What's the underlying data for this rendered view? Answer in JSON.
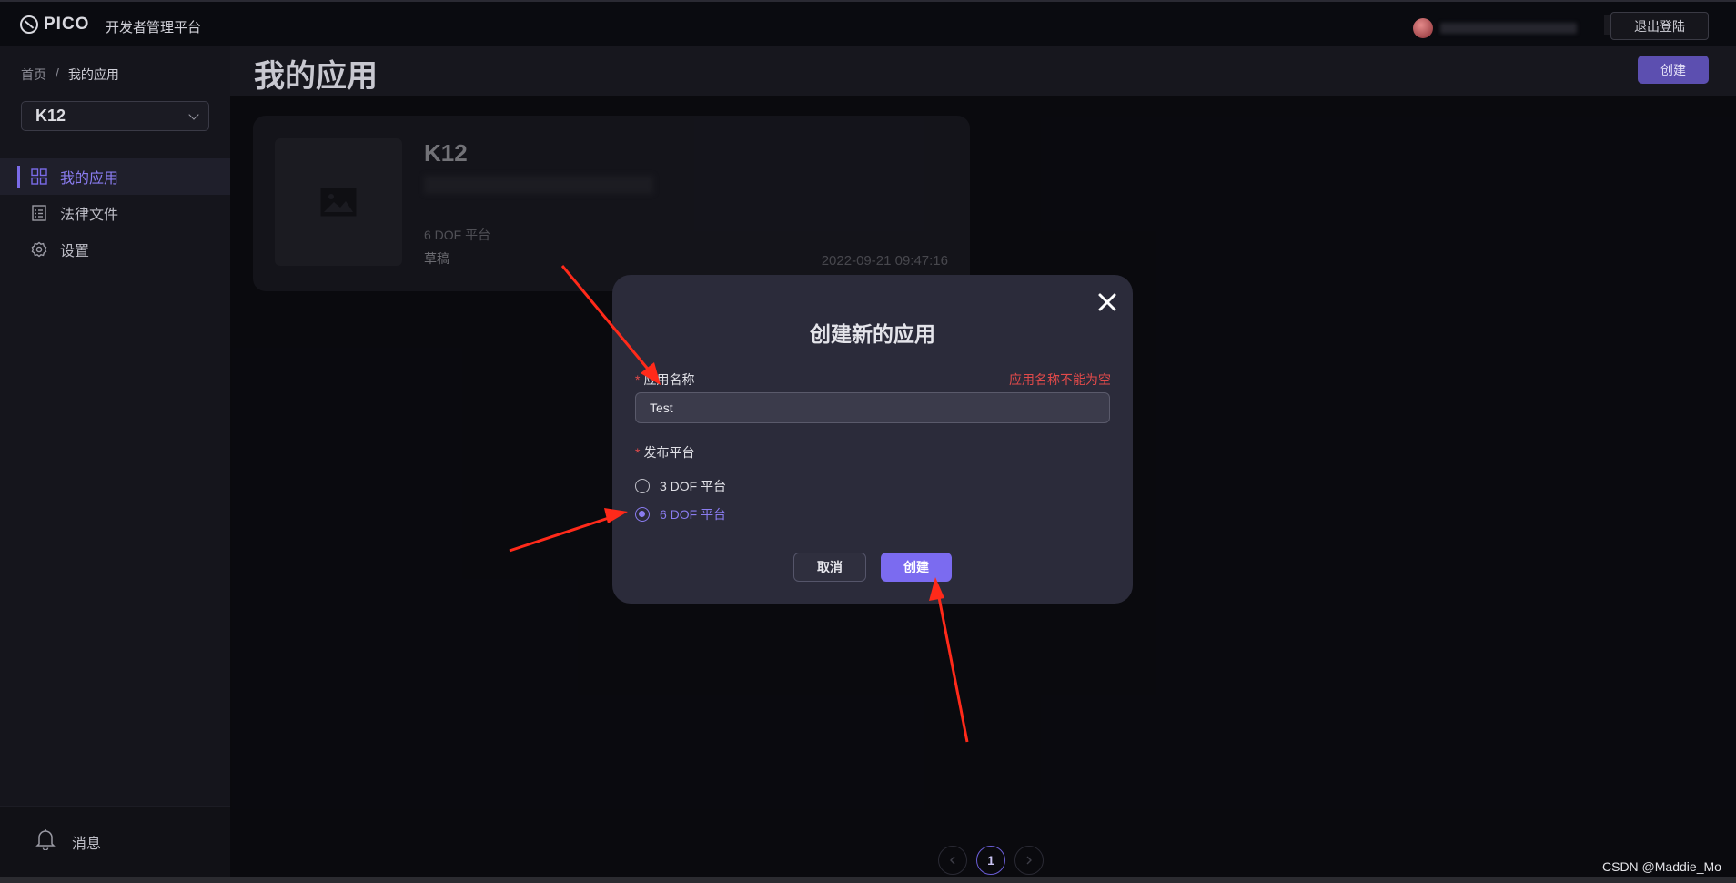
{
  "topbar": {
    "brand": "PICO",
    "platform_title": "开发者管理平台",
    "logout_label": "退出登陆"
  },
  "sidebar": {
    "breadcrumb": {
      "home": "首页",
      "separator": "/",
      "current": "我的应用"
    },
    "app_selector": "K12",
    "items": [
      {
        "label": "我的应用",
        "icon": "grid-icon",
        "active": true
      },
      {
        "label": "法律文件",
        "icon": "document-icon",
        "active": false
      },
      {
        "label": "设置",
        "icon": "gear-icon",
        "active": false
      }
    ],
    "footer": {
      "label": "消息",
      "icon": "bell-icon"
    }
  },
  "main": {
    "page_title": "我的应用",
    "create_label": "创建",
    "app_card": {
      "name": "K12",
      "platform": "6 DOF 平台",
      "status": "草稿",
      "date": "2022-09-21 09:47:16"
    },
    "pagination": {
      "current": "1"
    }
  },
  "modal": {
    "title": "创建新的应用",
    "name_label": "应用名称",
    "name_required_mark": "*",
    "name_error": "应用名称不能为空",
    "name_value": "Test",
    "platform_label": "发布平台",
    "platform_required_mark": "*",
    "options": [
      {
        "label": "3 DOF 平台",
        "checked": false
      },
      {
        "label": "6 DOF 平台",
        "checked": true
      }
    ],
    "cancel_label": "取消",
    "create_label": "创建"
  },
  "watermark": "CSDN @Maddie_Mo",
  "colors": {
    "accent": "#7b6bf0",
    "error": "#e14a4a",
    "annotation_arrow": "#ff2a1a"
  }
}
